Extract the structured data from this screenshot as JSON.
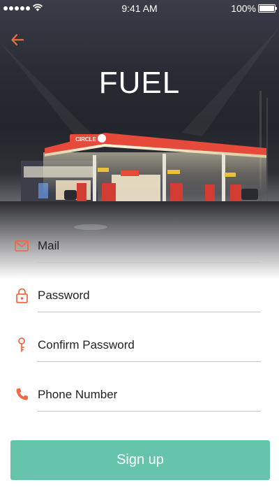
{
  "status_bar": {
    "time": "9:41 AM",
    "battery": "100%"
  },
  "header": {
    "title": "FUEL",
    "back_icon": "arrow-left-icon"
  },
  "hero": {
    "sign_text": "CIRCLE K"
  },
  "form": {
    "fields": [
      {
        "placeholder": "Mail",
        "icon": "mail-icon"
      },
      {
        "placeholder": "Password",
        "icon": "lock-icon"
      },
      {
        "placeholder": "Confirm Password",
        "icon": "key-icon"
      },
      {
        "placeholder": "Phone Number",
        "icon": "phone-icon"
      }
    ],
    "submit_label": "Sign up"
  },
  "colors": {
    "accent": "#ef6b47",
    "button": "#66c4ad",
    "divider": "#c7c7c7"
  }
}
